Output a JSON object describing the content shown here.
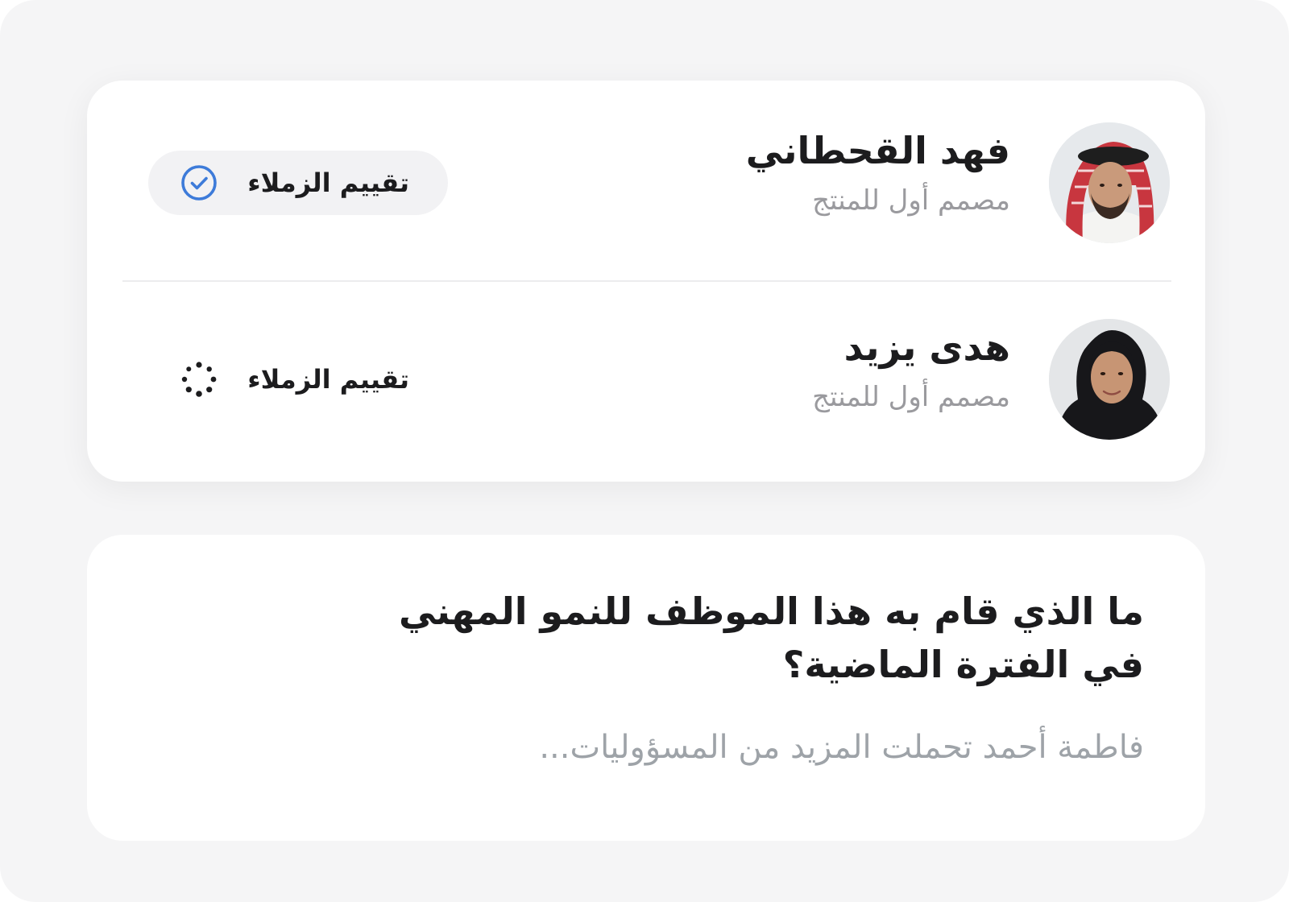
{
  "colleagues": [
    {
      "name": "فهد القحطاني",
      "title": "مصمم أول للمنتج",
      "peer_review_label": "تقييم الزملاء",
      "peer_review_status": "completed",
      "status_icon": "check-circle-icon"
    },
    {
      "name": "هدى يزيد",
      "title": "مصمم أول للمنتج",
      "peer_review_label": "تقييم الزملاء",
      "peer_review_status": "in-progress",
      "status_icon": "loading-spinner-icon"
    }
  ],
  "question": {
    "title": "ما الذي قام به هذا الموظف للنمو المهني في الفترة الماضية؟",
    "answer_preview": "فاطمة أحمد تحملت المزيد من المسؤوليات..."
  },
  "colors": {
    "accent": "#3d7bd9",
    "text_primary": "#1c1c1e",
    "text_secondary": "#9a9a9e",
    "pill_background": "#f2f2f4",
    "page_background": "#f5f5f6"
  }
}
